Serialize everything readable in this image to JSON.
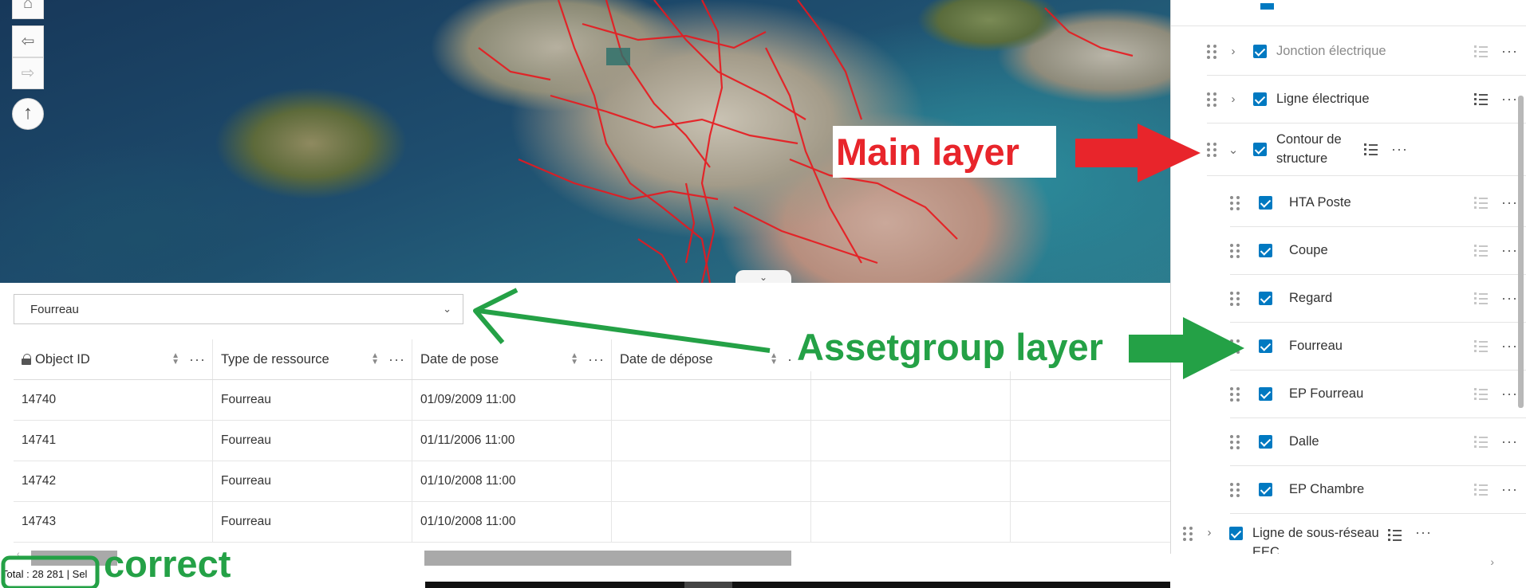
{
  "map": {
    "home_icon": "home-icon",
    "back_icon": "arrow-left-icon",
    "forward_icon": "arrow-right-icon",
    "compass_icon": "compass-arrow-icon",
    "collapse_icon": "chevron-down-icon"
  },
  "table": {
    "layer_select": {
      "value": "Fourreau"
    },
    "columns": [
      "Object ID",
      "Type de ressource",
      "Date de pose",
      "Date de dépose",
      "",
      ""
    ],
    "rows": [
      [
        "14740",
        "Fourreau",
        "01/09/2009 11:00",
        "",
        "",
        ""
      ],
      [
        "14741",
        "Fourreau",
        "01/11/2006 11:00",
        "",
        "",
        ""
      ],
      [
        "14742",
        "Fourreau",
        "01/10/2008 11:00",
        "",
        "",
        ""
      ],
      [
        "14743",
        "Fourreau",
        "01/10/2008 11:00",
        "",
        "",
        ""
      ]
    ],
    "status": "Total : 28 281 | Sel"
  },
  "layers": {
    "items": [
      {
        "label": "Jonction électrique",
        "expander": "›",
        "dim": true
      },
      {
        "label": "Ligne électrique",
        "expander": "›",
        "dim": false
      },
      {
        "label": "Contour de structure",
        "expander": "⌄",
        "dim": false
      },
      {
        "label": "HTA Poste",
        "dim": true
      },
      {
        "label": "Coupe",
        "dim": true
      },
      {
        "label": "Regard",
        "dim": true
      },
      {
        "label": "Fourreau",
        "dim": true
      },
      {
        "label": "EP Fourreau",
        "dim": true
      },
      {
        "label": "Dalle",
        "dim": true
      },
      {
        "label": "EP Chambre",
        "dim": true
      },
      {
        "label": "Ligne de sous-réseau EEC",
        "expander": "›",
        "dim": false
      }
    ]
  },
  "annotations": {
    "main_layer": "Main layer",
    "assetgroup_layer": "Assetgroup layer",
    "correct": "correct",
    "red_color": "#e8252b",
    "green_color": "#24a146"
  }
}
